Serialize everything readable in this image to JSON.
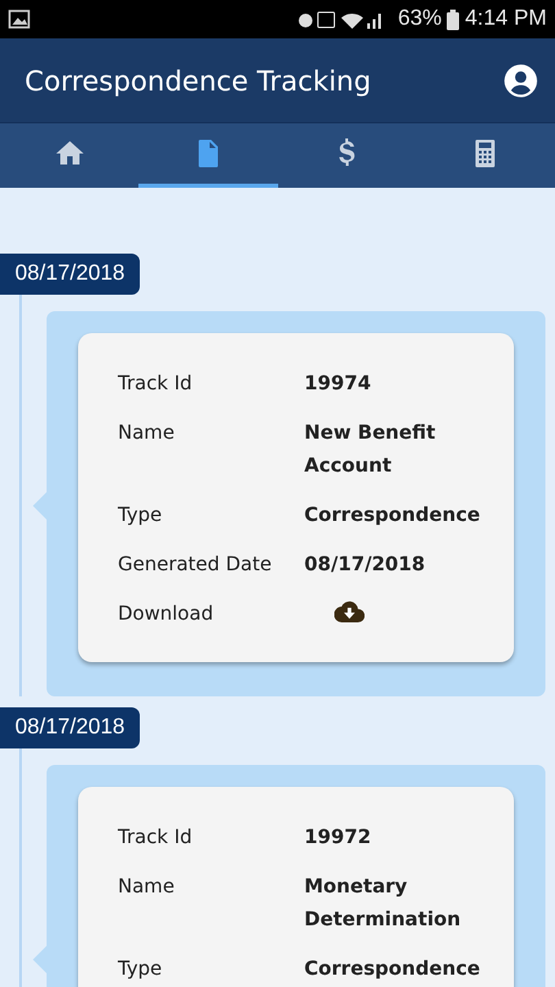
{
  "status_bar": {
    "battery": "63%",
    "time": "4:14 PM"
  },
  "header": {
    "title": "Correspondence Tracking"
  },
  "tabs": [
    {
      "kind": "home",
      "selected": false
    },
    {
      "kind": "document",
      "selected": true
    },
    {
      "kind": "dollar",
      "selected": false
    },
    {
      "kind": "calculator",
      "selected": false
    }
  ],
  "entries": [
    {
      "date": "08/17/2018",
      "fields": [
        {
          "kind": "text",
          "label": "Track Id",
          "value": "19974"
        },
        {
          "kind": "text",
          "label": "Name",
          "value": "New Benefit Account"
        },
        {
          "kind": "text",
          "label": "Type",
          "value": "Correspondence"
        },
        {
          "kind": "text",
          "label": "Generated Date",
          "value": "08/17/2018"
        },
        {
          "kind": "download",
          "label": "Download"
        }
      ]
    },
    {
      "date": "08/17/2018",
      "fields": [
        {
          "kind": "text",
          "label": "Track Id",
          "value": "19972"
        },
        {
          "kind": "text",
          "label": "Name",
          "value": "Monetary Determination"
        },
        {
          "kind": "text",
          "label": "Type",
          "value": "Correspondence"
        }
      ]
    }
  ]
}
